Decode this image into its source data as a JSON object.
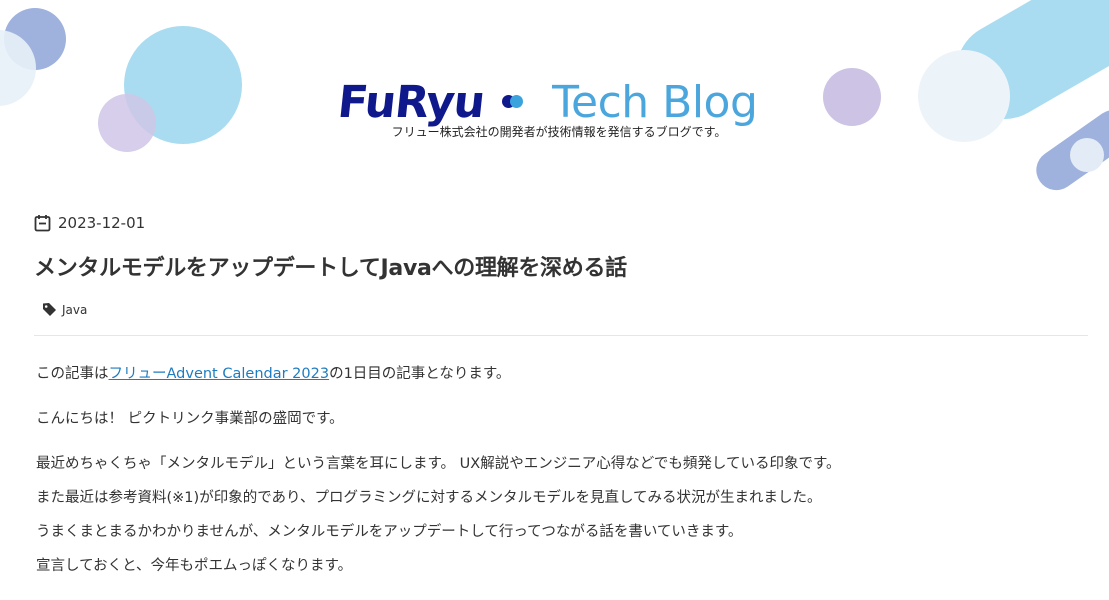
{
  "header": {
    "logo_furyu": "FuRyu",
    "logo_tech": "Tech Blog",
    "tagline": "フリュー株式会社の開発者が技術情報を発信するブログです。"
  },
  "post": {
    "date": "2023-12-01",
    "title": "メンタルモデルをアップデートしてJavaへの理解を深める話",
    "tag": "Java"
  },
  "content": {
    "p1_before": "この記事は",
    "p1_link": "フリューAdvent Calendar 2023",
    "p1_after": "の1日目の記事となります。",
    "p2": "こんにちは！ ピクトリンク事業部の盛岡です。",
    "p3_lines": [
      "最近めちゃくちゃ「メンタルモデル」という言葉を耳にします。 UX解説やエンジニア心得などでも頻発している印象です。",
      "また最近は参考資料(※1)が印象的であり、プログラミングに対するメンタルモデルを見直してみる状況が生まれました。",
      "うまくまとまるかわかりませんが、メンタルモデルをアップデートして行ってつながる話を書いていきます。",
      "宣言しておくと、今年もポエムっぽくなります。"
    ]
  },
  "icons": {
    "date": "calendar-icon",
    "tag": "tag-icon"
  },
  "colors": {
    "logo_navy": "#10198c",
    "logo_blue": "#4aa6dc",
    "link": "#1e7cc0",
    "bubble_light_blue": "#a9dcf1",
    "bubble_lavender": "#cfc6e6",
    "bubble_periwinkle": "#9fb2dd"
  }
}
